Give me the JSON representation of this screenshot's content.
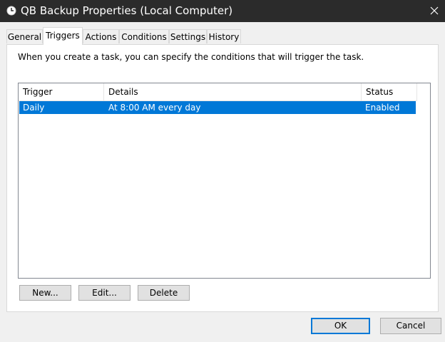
{
  "window": {
    "title": "QB Backup Properties (Local Computer)",
    "icon": "clock-icon",
    "close_icon": "close-icon"
  },
  "tabs": [
    {
      "label": "General"
    },
    {
      "label": "Triggers"
    },
    {
      "label": "Actions"
    },
    {
      "label": "Conditions"
    },
    {
      "label": "Settings"
    },
    {
      "label": "History"
    }
  ],
  "active_tab": "Triggers",
  "intro_text": "When you create a task, you can specify the conditions that will trigger the task.",
  "triggers_table": {
    "columns": [
      "Trigger",
      "Details",
      "Status"
    ],
    "rows": [
      {
        "trigger": "Daily",
        "details": "At 8:00 AM every day",
        "status": "Enabled",
        "selected": true
      }
    ]
  },
  "buttons": {
    "new": "New...",
    "edit": "Edit...",
    "delete": "Delete",
    "ok": "OK",
    "cancel": "Cancel"
  },
  "colors": {
    "title_bar": "#2b2b2b",
    "selection": "#0078d7",
    "default_button_border": "#0078d7"
  }
}
